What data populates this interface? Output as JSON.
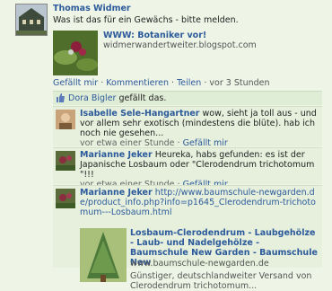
{
  "post": {
    "author": "Thomas Widmer",
    "text": "Was ist das für ein Gewächs - bitte melden.",
    "attachment": {
      "title": "WWW: Botaniker vor!",
      "url": "widmerwandertweiter.blogspot.com"
    },
    "actions": {
      "like": "Gefällt mir",
      "comment": "Kommentieren",
      "share": "Teilen",
      "sep": "·",
      "time": "vor 3 Stunden"
    }
  },
  "likes": {
    "name": "Dora Bigler",
    "suffix": "gefällt das."
  },
  "comments": [
    {
      "author": "Isabelle Sele-Hangartner",
      "text": "wow, sieht ja toll aus - und vor allem sehr exotisch (mindestens die blüte). hab ich noch nie gesehen...",
      "time": "vor etwa einer Stunde",
      "like": "Gefällt mir"
    },
    {
      "author": "Marianne Jeker",
      "text": "Heureka, habs gefunden: es ist der Japanische Losbaum oder \"Clerodendrum trichotomum \"!!!",
      "time": "vor etwa einer Stunde",
      "like": "Gefällt mir"
    },
    {
      "author": "Marianne Jeker",
      "link": "http://www.baumschule-newgarden.de/product_info.php?info=p1645_Clerodendrum-trichotomum---Losbaum.html",
      "attachment": {
        "title": "Losbaum-Clerodendrum - Laubgehölze - Laub- und Nadelgehölze - Baumschule New Garden - Baumschule New",
        "url": "www.baumschule-newgarden.de",
        "desc": "Günstiger, deutschlandweiter Versand von Clerodendrum trichotomum..."
      }
    }
  ]
}
